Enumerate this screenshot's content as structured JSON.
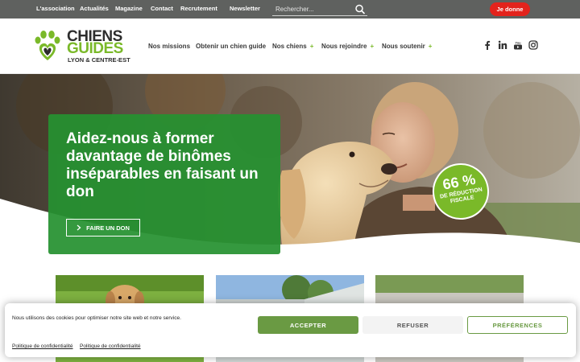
{
  "topbar": {
    "links": [
      "L'association",
      "Actualités",
      "Magazine",
      "Contact",
      "Recrutement",
      "Newsletter"
    ],
    "search_placeholder": "Rechercher...",
    "search_icon": "search-icon",
    "donate_label": "Je donne"
  },
  "header": {
    "logo": {
      "line1": "CHIENS",
      "line2": "GUIDES",
      "line3": "LYON & CENTRE-EST"
    },
    "nav": [
      {
        "label": "Nos missions",
        "has_submenu": false
      },
      {
        "label": "Obtenir un chien guide",
        "has_submenu": false
      },
      {
        "label": "Nos chiens",
        "has_submenu": true
      },
      {
        "label": "Nous rejoindre",
        "has_submenu": true
      },
      {
        "label": "Nous soutenir",
        "has_submenu": true
      }
    ],
    "submenu_marker": "+",
    "social_icons": [
      "facebook-icon",
      "linkedin-icon",
      "youtube-icon",
      "instagram-icon"
    ]
  },
  "hero": {
    "title": "Aidez-nous à former davantage de binômes inséparables en faisant un don",
    "cta_label": "FAIRE UN DON",
    "cta_icon": "chevron-right-icon",
    "badge_value": "66 %",
    "badge_text": "DE RÉDUCTION FISCALE"
  },
  "cookie_banner": {
    "message": "Nous utilisons des cookies pour optimiser notre site web et notre service.",
    "accept_label": "ACCEPTER",
    "refuse_label": "REFUSER",
    "preferences_label": "PRÉFÉRENCES",
    "links": [
      "Politique de confidentialité",
      "Politique de confidentialité"
    ]
  },
  "colors": {
    "topbar": "#5f615f",
    "brand_green": "#7ab929",
    "hero_green": "#269130",
    "donate_red": "#e3231c",
    "accept_green": "#6a9a43"
  }
}
